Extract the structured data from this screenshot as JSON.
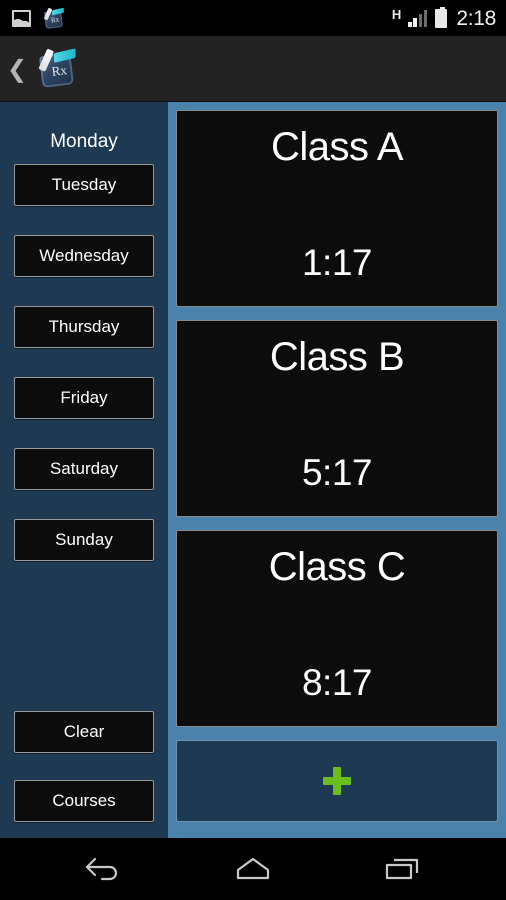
{
  "status_bar": {
    "left_icons": [
      "screenshot-icon",
      "pocket-app-notification-icon"
    ],
    "network_label": "H",
    "signal_icon": "signal-bars-icon",
    "battery_icon": "battery-icon",
    "time": "2:18"
  },
  "action_bar": {
    "back_label": "❮",
    "app_icon": "pocket-app-icon",
    "app_icon_text": "Rx",
    "title": ""
  },
  "sidebar": {
    "current_day": "Monday",
    "days": [
      {
        "label": "Tuesday"
      },
      {
        "label": "Wednesday"
      },
      {
        "label": "Thursday"
      },
      {
        "label": "Friday"
      },
      {
        "label": "Saturday"
      },
      {
        "label": "Sunday"
      }
    ],
    "actions": [
      {
        "label": "Clear"
      },
      {
        "label": "Courses"
      }
    ]
  },
  "schedule": {
    "classes": [
      {
        "name": "Class A",
        "time": "1:17"
      },
      {
        "name": "Class B",
        "time": "5:17"
      },
      {
        "name": "Class C",
        "time": "8:17"
      }
    ],
    "add_button": {
      "icon": "plus-icon",
      "label": "+"
    }
  },
  "nav_bar": {
    "buttons": [
      {
        "name": "back-icon"
      },
      {
        "name": "home-icon"
      },
      {
        "name": "recents-icon"
      }
    ]
  },
  "colors": {
    "sidebar_bg": "#1e3a52",
    "panel_bg": "#4a82ab",
    "card_bg": "#0c0c0c",
    "accent_green": "#6cbe1e",
    "text": "#ffffff"
  }
}
